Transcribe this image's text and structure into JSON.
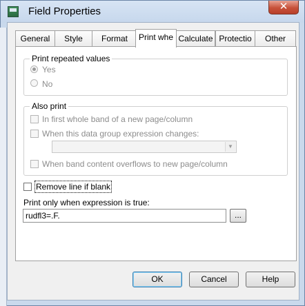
{
  "window": {
    "title": "Field Properties",
    "close_glyph": "✕"
  },
  "tabs": [
    {
      "label": "General"
    },
    {
      "label": "Style"
    },
    {
      "label": "Format"
    },
    {
      "label": "Print whe",
      "active": true
    },
    {
      "label": "Calculate"
    },
    {
      "label": "Protectio"
    },
    {
      "label": "Other"
    }
  ],
  "print_repeated": {
    "legend": "Print repeated values",
    "yes_label": "Yes",
    "no_label": "No",
    "selected": "Yes"
  },
  "also_print": {
    "legend": "Also print",
    "first_band_label": "In first whole band of a new page/column",
    "group_change_label": "When this data group expression changes:",
    "group_expression_value": "",
    "overflow_label": "When band content overflows to new page/column"
  },
  "remove_line": {
    "label": "Remove line if blank",
    "checked": false
  },
  "print_only": {
    "label": "Print only when expression is true:",
    "value": "rudfl3=.F.",
    "browse_label": "..."
  },
  "buttons": {
    "ok": "OK",
    "cancel": "Cancel",
    "help": "Help"
  },
  "colors": {
    "title_bar": "#c9d9ec",
    "close_button": "#c7513a",
    "disabled_text": "#8c8c8c"
  }
}
